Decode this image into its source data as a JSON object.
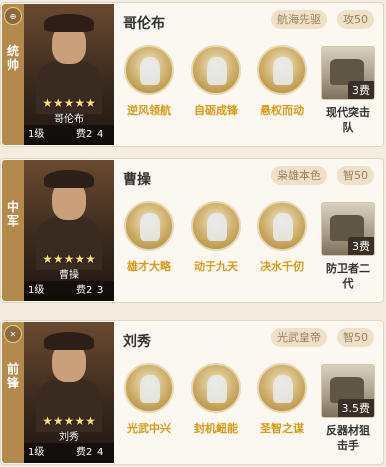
{
  "cards": [
    {
      "position_label": "统\n帅",
      "badge_icon": "rank-badge-icon",
      "hero_name": "哥伦布",
      "stars": "★★★★★",
      "level": "1级",
      "fee": "费2",
      "extra": "4",
      "title": "哥伦布",
      "tag": "航海先驱",
      "stat": "攻50",
      "skills": [
        "逆风领航",
        "自砺成锋",
        "悬权而动"
      ],
      "troop_name": "现代突击队",
      "troop_cost": "3费"
    },
    {
      "position_label": "中\n军",
      "badge_icon": "",
      "hero_name": "曹操",
      "stars": "★★★★★",
      "level": "1级",
      "fee": "费2",
      "extra": "3",
      "title": "曹操",
      "tag": "枭雄本色",
      "stat": "智50",
      "skills": [
        "雄才大略",
        "动于九天",
        "决水千仞"
      ],
      "troop_name": "防卫者二代",
      "troop_cost": "3费"
    },
    {
      "position_label": "前\n锋",
      "badge_icon": "close-badge-icon",
      "hero_name": "刘秀",
      "stars": "★★★★★",
      "level": "1级",
      "fee": "费2",
      "extra": "4",
      "title": "刘秀",
      "tag": "光武皇帝",
      "stat": "智50",
      "skills": [
        "光武中兴",
        "封机衄能",
        "圣智之谋"
      ],
      "troop_name": "反器材狙击手",
      "troop_cost": "3.5费"
    }
  ]
}
